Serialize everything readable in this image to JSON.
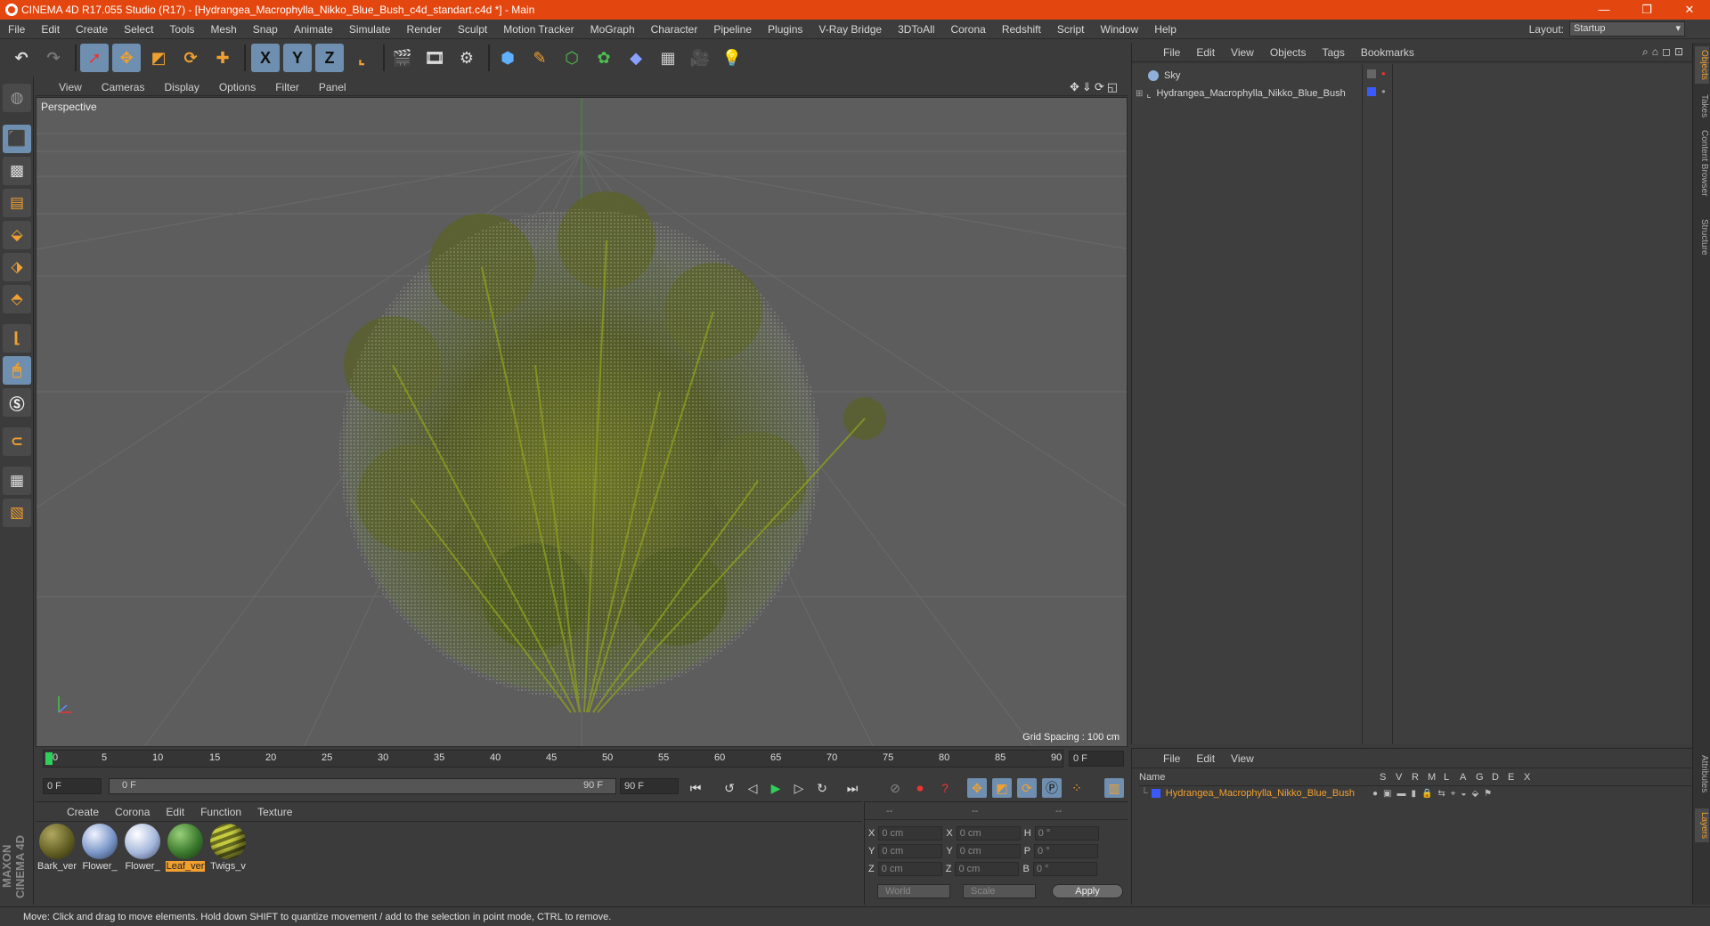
{
  "window": {
    "title": "CINEMA 4D R17.055 Studio (R17) - [Hydrangea_Macrophylla_Nikko_Blue_Bush_c4d_standart.c4d *] - Main",
    "minimize": "—",
    "restore": "❐",
    "close": "✕"
  },
  "menubar": {
    "items": [
      "File",
      "Edit",
      "Create",
      "Select",
      "Tools",
      "Mesh",
      "Snap",
      "Animate",
      "Simulate",
      "Render",
      "Sculpt",
      "Motion Tracker",
      "MoGraph",
      "Character",
      "Pipeline",
      "Plugins",
      "V-Ray Bridge",
      "3DToAll",
      "Corona",
      "Redshift",
      "Script",
      "Window",
      "Help"
    ],
    "layout_label": "Layout:",
    "layout_value": "Startup"
  },
  "toolbar": {
    "x_label": "X",
    "y_label": "Y",
    "z_label": "Z"
  },
  "viewport": {
    "menu": [
      "View",
      "Cameras",
      "Display",
      "Options",
      "Filter",
      "Panel"
    ],
    "label": "Perspective",
    "grid_spacing": "Grid Spacing : 100 cm"
  },
  "objects_panel": {
    "menu": [
      "File",
      "Edit",
      "View",
      "Objects",
      "Tags",
      "Bookmarks"
    ],
    "objects": [
      {
        "name": "Sky"
      },
      {
        "name": "Hydrangea_Macrophylla_Nikko_Blue_Bush"
      }
    ]
  },
  "side_tabs": [
    "Objects",
    "Takes",
    "Content Browser",
    "Structure"
  ],
  "side_tabs_lower": [
    "Attributes",
    "Layers"
  ],
  "layers_panel": {
    "menu": [
      "File",
      "Edit",
      "View"
    ],
    "columns": [
      "Name",
      "S",
      "V",
      "R",
      "M",
      "L",
      "A",
      "G",
      "D",
      "E",
      "X"
    ],
    "layer_name": "Hydrangea_Macrophylla_Nikko_Blue_Bush"
  },
  "timeline": {
    "ticks": [
      "0",
      "5",
      "10",
      "15",
      "20",
      "25",
      "30",
      "35",
      "40",
      "45",
      "50",
      "55",
      "60",
      "65",
      "70",
      "75",
      "80",
      "85",
      "90"
    ],
    "current_frame_field": "0 F",
    "start_field": "0 F",
    "range_start": "0 F",
    "range_end": "90 F",
    "end_field": "90 F"
  },
  "material_manager": {
    "menu": [
      "Create",
      "Corona",
      "Edit",
      "Function",
      "Texture"
    ],
    "materials": [
      {
        "name": "Bark_ver",
        "color": "#6e6a2a"
      },
      {
        "name": "Flower_",
        "color": "#8ea6d6"
      },
      {
        "name": "Flower_",
        "color": "#b4c6e6"
      },
      {
        "name": "Leaf_ver",
        "color": "#3c7a2e",
        "selected": true
      },
      {
        "name": "Twigs_v",
        "color": "#9aa02e"
      }
    ]
  },
  "coordinates": {
    "headers": [
      "--",
      "--",
      "--"
    ],
    "rows": [
      {
        "a": "X",
        "av": "0 cm",
        "b": "X",
        "bv": "0 cm",
        "c": "H",
        "cv": "0 °"
      },
      {
        "a": "Y",
        "av": "0 cm",
        "b": "Y",
        "bv": "0 cm",
        "c": "P",
        "cv": "0 °"
      },
      {
        "a": "Z",
        "av": "0 cm",
        "b": "Z",
        "bv": "0 cm",
        "c": "B",
        "cv": "0 °"
      }
    ],
    "world": "World",
    "scale": "Scale",
    "apply": "Apply"
  },
  "status": {
    "text": "Move: Click and drag to move elements. Hold down SHIFT to quantize movement / add to the selection in point mode, CTRL to remove."
  },
  "branding": "MAXON CINEMA 4D",
  "colors": {
    "accent": "#e3460f",
    "selected_blue": "#6f8fb0",
    "highlight_orange": "#f0a030"
  }
}
